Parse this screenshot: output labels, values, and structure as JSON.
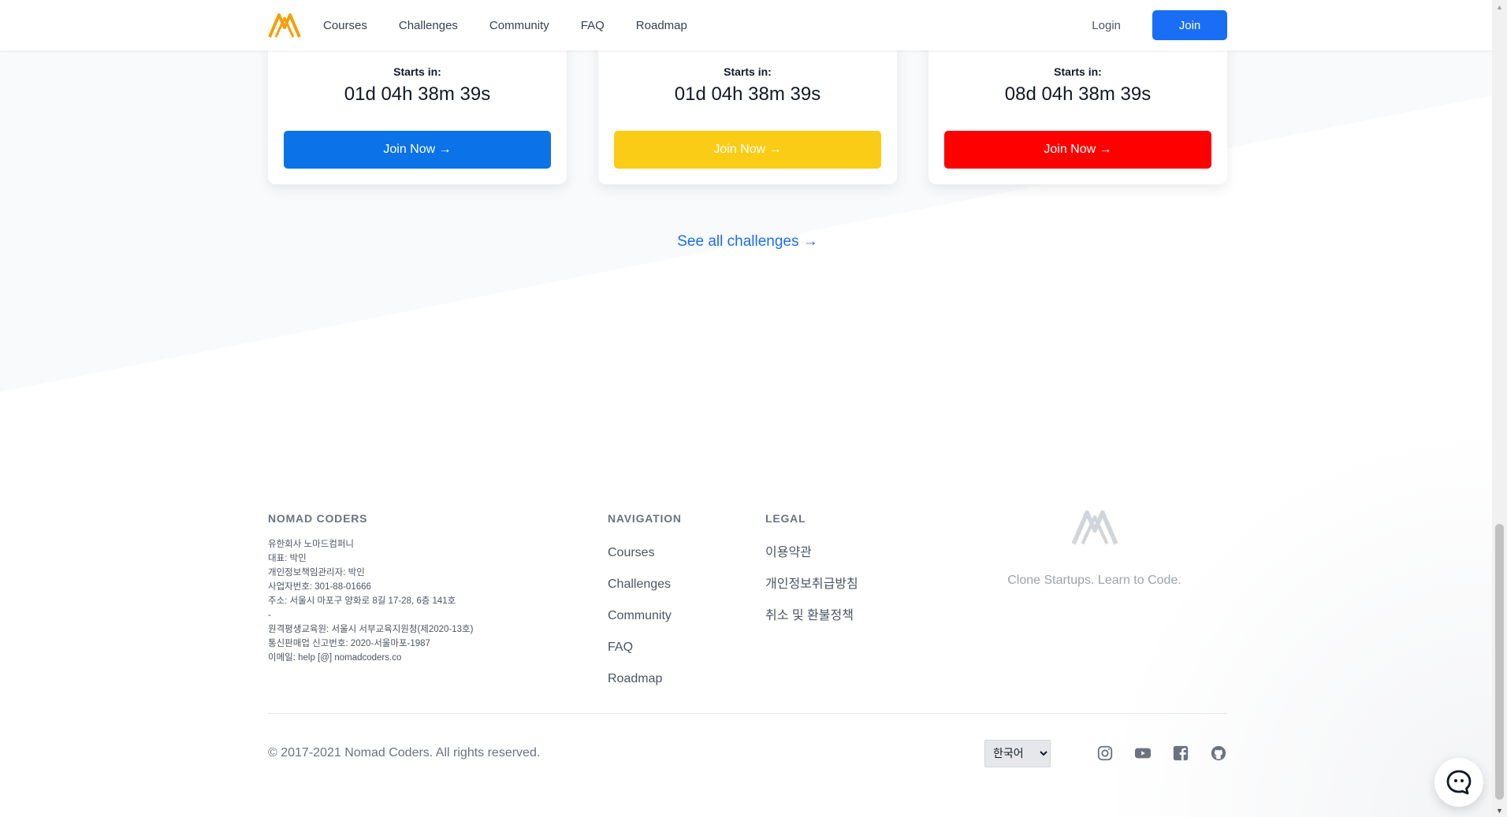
{
  "header": {
    "nav": [
      "Courses",
      "Challenges",
      "Community",
      "FAQ",
      "Roadmap"
    ],
    "login": "Login",
    "join": "Join"
  },
  "cards": [
    {
      "starts_label": "Starts in:",
      "countdown": "01d 04h 38m 39s",
      "button": "Join Now →",
      "color": "#0b72e7"
    },
    {
      "starts_label": "Starts in:",
      "countdown": "01d 04h 38m 39s",
      "button": "Join Now →",
      "color": "#facc15"
    },
    {
      "starts_label": "Starts in:",
      "countdown": "08d 04h 38m 39s",
      "button": "Join Now →",
      "color": "#ff0000"
    }
  ],
  "see_all": "See all challenges →",
  "footer": {
    "company": {
      "title": "NOMAD CODERS",
      "lines": [
        "유한회사 노마드컴퍼니",
        "대표: 박인",
        "개인정보책임관리자: 박인",
        "사업자번호: 301-88-01666",
        "주소: 서울시 마포구 양화로 8길 17-28, 6층 141호",
        "-",
        "원격평생교육원: 서울시 서부교육지원청(제2020-13호)",
        "통신판매업 신고번호: 2020-서울마포-1987",
        "이메일: help [@] nomadcoders.co"
      ]
    },
    "navigation": {
      "title": "NAVIGATION",
      "links": [
        "Courses",
        "Challenges",
        "Community",
        "FAQ",
        "Roadmap"
      ]
    },
    "legal": {
      "title": "LEGAL",
      "links": [
        "이용약관",
        "개인정보취급방침",
        "취소 및 환불정책"
      ]
    },
    "tagline": "Clone Startups. Learn to Code.",
    "copyright": "© 2017-2021 Nomad Coders. All rights reserved.",
    "language": "한국어",
    "socials": [
      "instagram-icon",
      "youtube-icon",
      "facebook-icon",
      "github-icon"
    ]
  },
  "colors": {
    "brand_blue": "#1a6ef5",
    "logo_orange": "#f59e0b"
  }
}
